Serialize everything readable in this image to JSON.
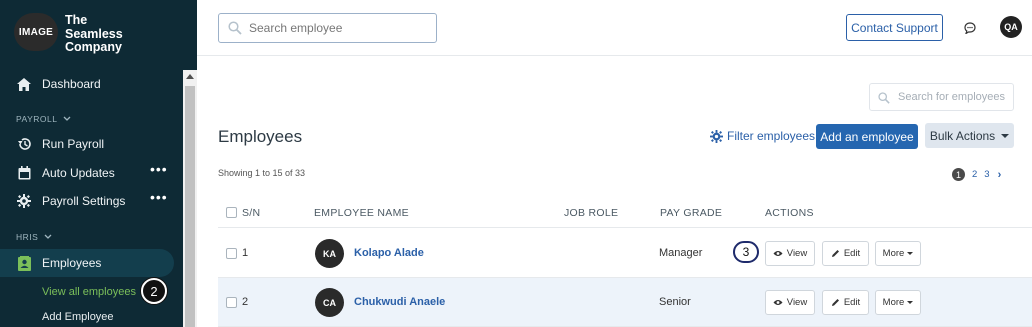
{
  "sidebar": {
    "logo_text": "IMAGE",
    "company_name": "The Seamless Company",
    "dashboard": "Dashboard",
    "payroll_section": "PAYROLL",
    "run_payroll": "Run Payroll",
    "auto_updates": "Auto Updates",
    "payroll_settings": "Payroll Settings",
    "hris_section": "HRIS",
    "employees": "Employees",
    "view_all": "View all employees",
    "add_employee": "Add Employee",
    "dots": "•••"
  },
  "steps": {
    "two": "2",
    "three": "3"
  },
  "topbar": {
    "search_placeholder": "Search employee",
    "contact_support": "Contact Support",
    "user_initials": "QA"
  },
  "main": {
    "search_placeholder": "Search for employees",
    "title": "Employees",
    "filter": "Filter employees",
    "add": "Add an employee",
    "bulk": "Bulk Actions",
    "showing": "Showing 1 to 15 of 33",
    "pages": [
      "1",
      "2",
      "3"
    ],
    "next": "›"
  },
  "table": {
    "headers": {
      "sn": "S/N",
      "name": "EMPLOYEE NAME",
      "role": "JOB ROLE",
      "grade": "PAY GRADE",
      "actions": "ACTIONS"
    },
    "rows": [
      {
        "sn": "1",
        "initials": "KA",
        "name": "Kolapo Alade",
        "role": "",
        "grade": "Manager"
      },
      {
        "sn": "2",
        "initials": "CA",
        "name": "Chukwudi Anaele",
        "role": "",
        "grade": "Senior"
      }
    ],
    "view": "View",
    "edit": "Edit",
    "more": "More"
  },
  "colors": {
    "sidebar_bg": "#0e2a35",
    "accent": "#2566b0",
    "active_green": "#7bbf5a"
  }
}
